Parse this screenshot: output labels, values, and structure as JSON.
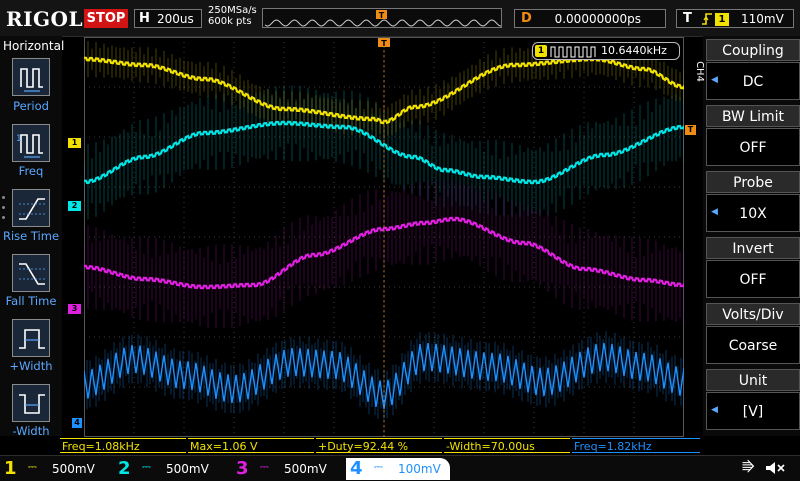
{
  "topbar": {
    "logo": "RIGOL",
    "run_state": "STOP",
    "timebase_label": "H",
    "timebase_value": "200us",
    "sample_rate": "250MSa/s",
    "memory_depth": "600k pts",
    "trigger_marker": "T",
    "delay_label": "D",
    "delay_value": "0.00000000ps",
    "trigger_label": "T",
    "trigger_edge": "rising",
    "trigger_source": "1",
    "trigger_level": "110mV"
  },
  "left_panel": {
    "title": "Horizontal",
    "buttons": [
      {
        "label": "Period",
        "icon": "period-icon"
      },
      {
        "label": "Freq",
        "icon": "frequency-icon"
      },
      {
        "label": "Rise Time",
        "icon": "rise-time-icon"
      },
      {
        "label": "Fall Time",
        "icon": "fall-time-icon"
      },
      {
        "label": "+Width",
        "icon": "positive-width-icon"
      },
      {
        "label": "-Width",
        "icon": "negative-width-icon"
      }
    ]
  },
  "screen": {
    "freq_counter_channel": "1",
    "freq_counter_value": "10.6440kHz",
    "channel_markers": [
      "1",
      "2",
      "3",
      "4"
    ],
    "trigger_marker": "T"
  },
  "right_menu": {
    "channel_tag": "CH4",
    "items": [
      {
        "title": "Coupling",
        "value": "DC"
      },
      {
        "title": "BW Limit",
        "value": "OFF"
      },
      {
        "title": "Probe",
        "value": "10X"
      },
      {
        "title": "Invert",
        "value": "OFF"
      },
      {
        "title": "Volts/Div",
        "value": "Coarse"
      },
      {
        "title": "Unit",
        "value": "[V]"
      }
    ]
  },
  "measurements": [
    {
      "text": "Freq=1.08kHz",
      "color": "#f2e200"
    },
    {
      "text": "Max=1.06 V",
      "color": "#f2e200"
    },
    {
      "text": "+Duty=92.44 %",
      "color": "#f2e200"
    },
    {
      "text": "-Width=70.00us",
      "color": "#f2e200"
    },
    {
      "text": "Freq=1.82kHz",
      "color": "#1e90ff"
    }
  ],
  "channels": [
    {
      "num": "1",
      "scale": "500mV",
      "color": "#f2e200"
    },
    {
      "num": "2",
      "scale": "500mV",
      "color": "#00e5e5"
    },
    {
      "num": "3",
      "scale": "500mV",
      "color": "#e020e0"
    },
    {
      "num": "4",
      "scale": "100mV",
      "color": "#1e90ff"
    }
  ],
  "colors": {
    "ch1": "#f2e200",
    "ch2": "#00e5e5",
    "ch3": "#e020e0",
    "ch4": "#1e90ff",
    "trigger": "#f08c14",
    "stop": "#d21414"
  },
  "icons": {
    "usb": "usb-icon",
    "speaker": "speaker-muted-icon"
  }
}
